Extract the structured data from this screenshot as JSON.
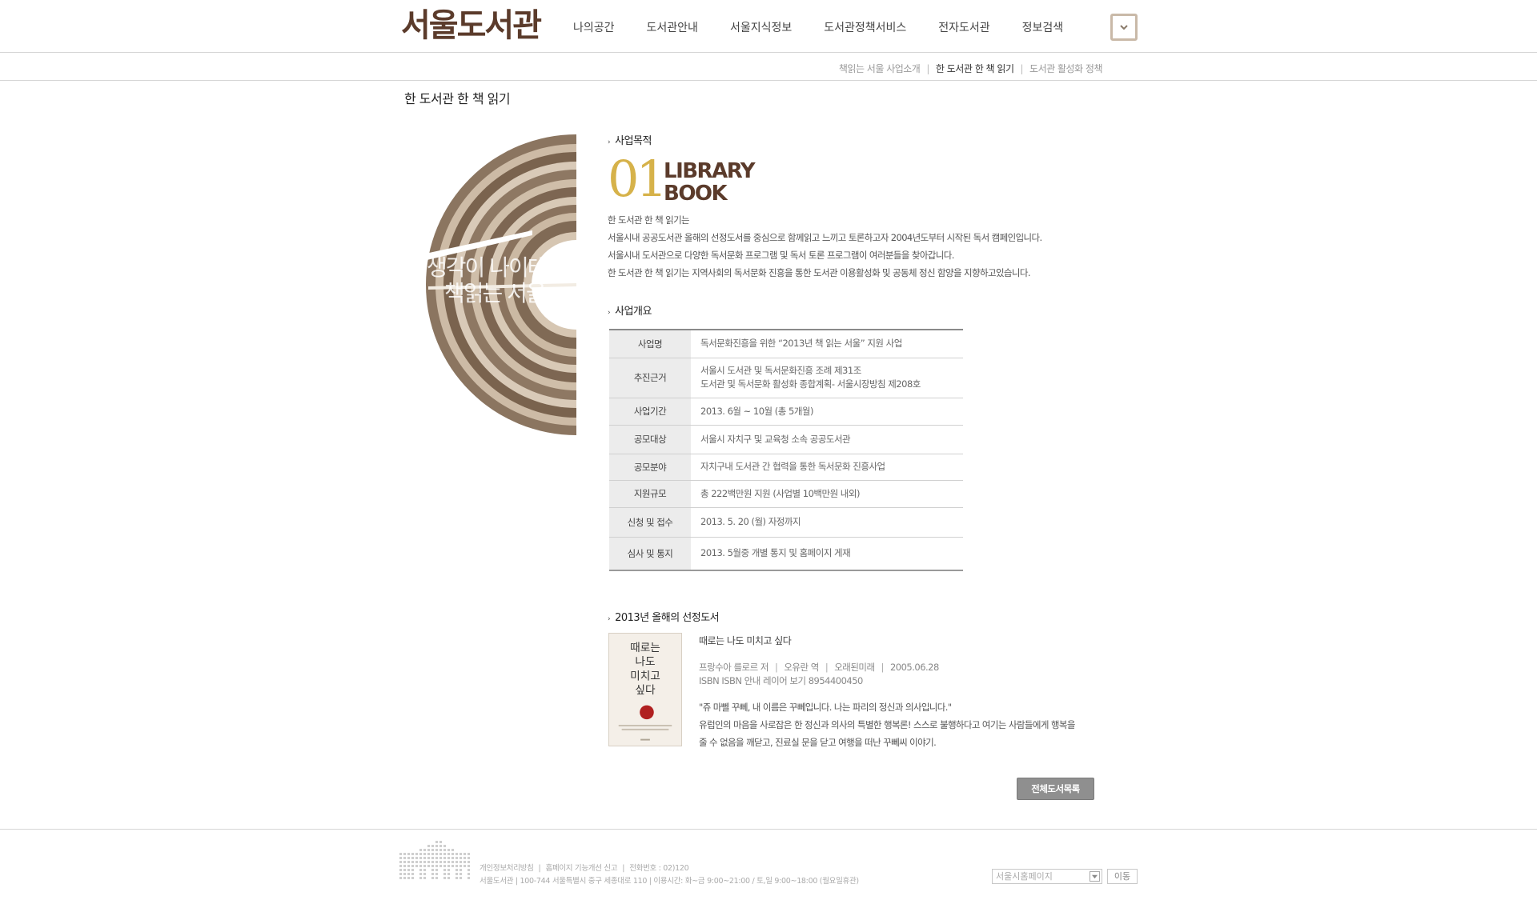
{
  "header": {
    "logo": "서울도서관",
    "nav": [
      "나의공간",
      "도서관안내",
      "서울지식정보",
      "도서관정책서비스",
      "전자도서관",
      "정보검색"
    ]
  },
  "subnav": {
    "items": [
      "책읽는 서울 사업소개",
      "한 도서관 한 책 읽기",
      "도서관 활성화 정책"
    ],
    "separator": "|"
  },
  "page": {
    "title": "한 도서관 한 책 읽기"
  },
  "graphic": {
    "line1": "생각이 나이테",
    "line2": "책읽는 서울"
  },
  "purpose": {
    "heading": "사업목적",
    "logo_number": "01",
    "logo_word1": "LIBRARY",
    "logo_word2": "BOOK",
    "lines": [
      "한 도서관 한 책 읽기는",
      "서울시내 공공도서관 올해의 선정도서를 중심으로 함께읽고 느끼고 토론하고자 2004년도부터 시작된 독서 캠페인입니다.",
      "서울시내 도서관으로 다양한 독서문화 프로그램 및 독서 토론 프로그램이 여러분들을 찾아갑니다.",
      "한 도서관 한 책 읽기는 지역사회의 독서문화 진흥을 통한 도서관 이용활성화 및 공동체 정신 함양을 지향하고있습니다."
    ]
  },
  "overview": {
    "heading": "사업개요",
    "rows": [
      {
        "label": "사업명",
        "value": "독서문화진흥을 위한 “2013년 책 읽는 서울” 지원 사업"
      },
      {
        "label": "추진근거",
        "value": "서울시 도서관 및 독서문화진흥 조례 제31조",
        "value2": "도서관 및 독서문화 활성화 종합계획- 서울시장방침 제208호"
      },
      {
        "label": "사업기간",
        "value": "2013. 6월 ~ 10월 (총 5개월)"
      },
      {
        "label": "공모대상",
        "value": "서울시 자치구 및 교육청 소속 공공도서관"
      },
      {
        "label": "공모분야",
        "value": "자치구내 도서관 간 협력을 통한 독서문화 진흥사업"
      },
      {
        "label": "지원규모",
        "value": "총 222백만원 지원 (사업별 10백만원 내외)"
      },
      {
        "label": "신청 및 접수",
        "value": "2013. 5. 20 (월) 자정까지"
      },
      {
        "label": "심사 및 통지",
        "value": "2013. 5월중 개별 통지 및 홈페이지 게재"
      }
    ]
  },
  "book": {
    "heading": "2013년 올해의 선정도서",
    "cover_text": [
      "때로는",
      "나도",
      "미치고",
      "싶다"
    ],
    "title": "때로는 나도 미치고 싶다",
    "author": "프랑수아 를로르 저",
    "translator": "오유란 역",
    "publisher": "오래된미래",
    "date": "2005.06.28",
    "isbn": "ISBN ISBN 안내 레이어 보기 8954400450",
    "desc": [
      "\"쥬 마뻴 꾸뻬, 내 이름은 꾸뻬입니다. 나는 파리의 정신과 의사입니다.\"",
      "유럽인의 마음을 사로잡은 한 정신과 의사의 특별한 행복론! 스스로 불행하다고 여기는 사람들에게 행복을",
      "줄 수 없음을 깨닫고, 진료실 문을 닫고 여행을 떠난 꾸뻬씨 이야기."
    ],
    "all_books_label": "전체도서목록"
  },
  "footer": {
    "links": [
      "개인정보처리방침",
      "홈페이지 기능개선 신고",
      "전화번호 : 02)120"
    ],
    "address": "서울도서관 | 100-744 서울특별시 중구 세종대로 110 | 이용시간: 화~금 9:00~21:00 / 토,일 9:00~18:00 (월요일휴관)",
    "select_placeholder": "서울시홈페이지",
    "go_label": "이동"
  },
  "colors": {
    "brand_brown": "#5b3b2b",
    "accent_gold": "#d6b24a",
    "button_gray": "#8f8f8f"
  }
}
